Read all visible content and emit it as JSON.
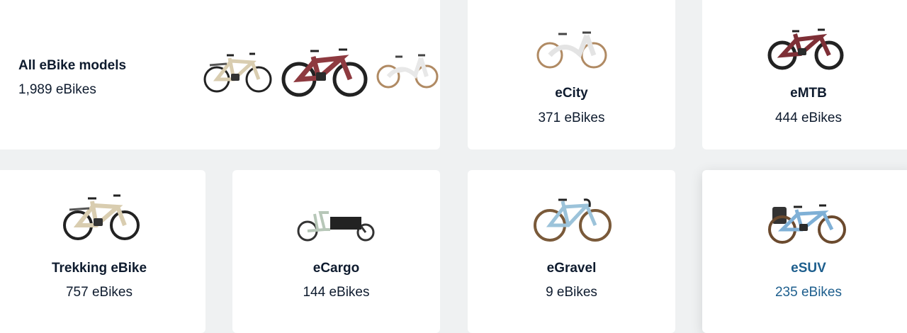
{
  "all_models": {
    "title": "All eBike models",
    "count": "1,989 eBikes"
  },
  "categories": [
    {
      "title": "eCity",
      "count": "371 eBikes",
      "icon": "city-bike"
    },
    {
      "title": "eMTB",
      "count": "444 eBikes",
      "icon": "mountain-bike"
    },
    {
      "title": "Trekking eBike",
      "count": "757 eBikes",
      "icon": "trekking-bike"
    },
    {
      "title": "eCargo",
      "count": "144 eBikes",
      "icon": "cargo-bike"
    },
    {
      "title": "eGravel",
      "count": "9 eBikes",
      "icon": "gravel-bike"
    },
    {
      "title": "eSUV",
      "count": "235 eBikes",
      "icon": "suv-bike"
    }
  ],
  "colors": {
    "text": "#0e1b2e",
    "hover_accent": "#1d5e8d",
    "background": "#eff1f2"
  }
}
